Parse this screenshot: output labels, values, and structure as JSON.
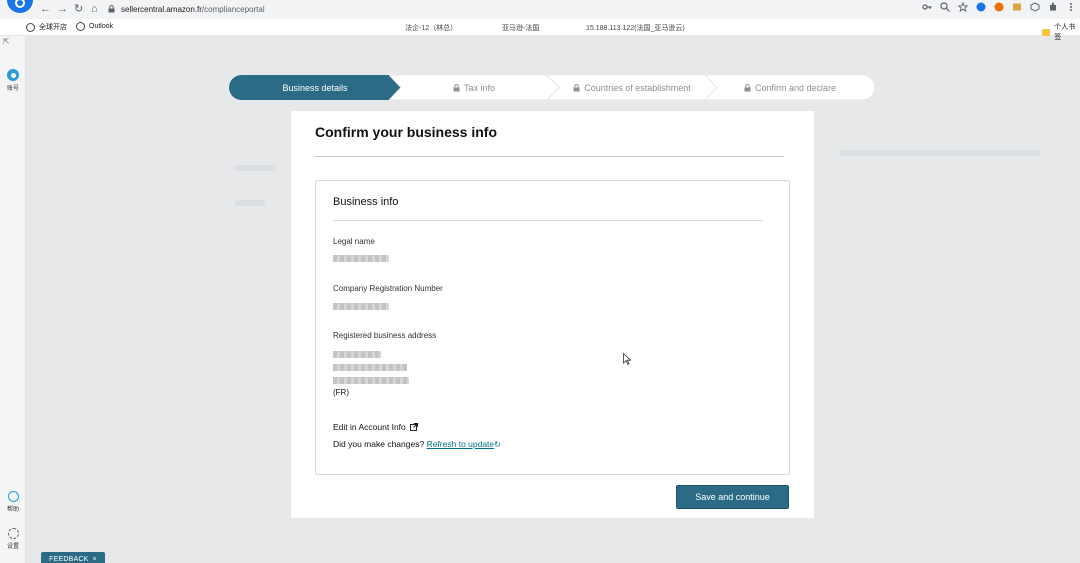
{
  "browser": {
    "url_domain": "sellercentral.amazon.fr",
    "url_path": "/complianceportal",
    "bookmarks": [
      "全球开店",
      "Outlook"
    ],
    "tab_info": [
      "法企-12（林总）",
      "亚马逊-法国",
      "15.188.113.122(法国_亚马逊云)"
    ],
    "right_folder": "个人书签"
  },
  "sidebar": {
    "items": [
      {
        "label": "账号",
        "icon": "account-icon"
      },
      {
        "label": "帮助",
        "icon": "help-icon"
      },
      {
        "label": "设置",
        "icon": "gear-icon"
      }
    ]
  },
  "stepper": {
    "steps": [
      {
        "label": "Business details",
        "active": true,
        "locked": false
      },
      {
        "label": "Tax info",
        "active": false,
        "locked": true
      },
      {
        "label": "Countries of establishment",
        "active": false,
        "locked": true
      },
      {
        "label": "Confirm and declare",
        "active": false,
        "locked": true
      }
    ]
  },
  "card": {
    "title": "Confirm your business info",
    "section_title": "Business info",
    "legal_name_label": "Legal name",
    "crn_label": "Company Registration Number",
    "address_label": "Registered business address",
    "address_country": "(FR)",
    "edit_link": "Edit in Account Info",
    "did_you_text": "Did you make changes?",
    "refresh_link": "Refresh to update",
    "save_button": "Save and continue"
  },
  "feedback": {
    "label": "FEEDBACK",
    "close": "×"
  },
  "colors": {
    "accent": "#2b6b86",
    "link": "#007185",
    "page_bg": "#e6e8ea"
  }
}
